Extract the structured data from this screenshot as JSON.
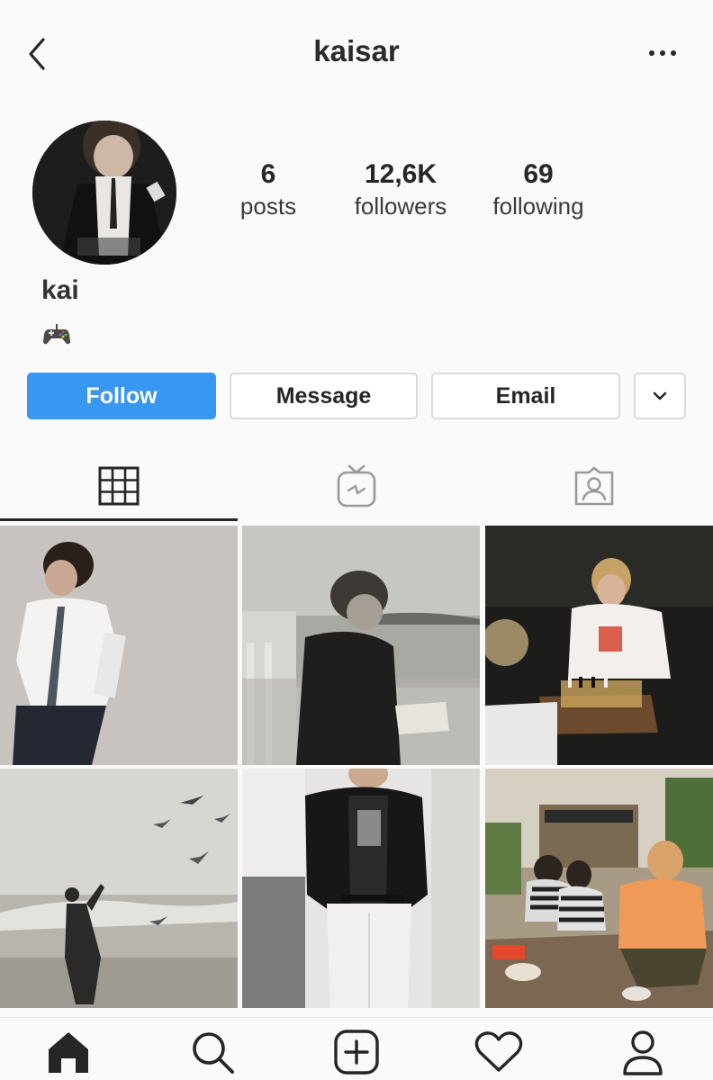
{
  "header": {
    "username": "kaisar",
    "back_icon": "chevron-left-icon",
    "more_icon": "more-horizontal-icon"
  },
  "profile": {
    "display_name": "kai",
    "bio_icon": "game-controller-emoji",
    "stats": [
      {
        "value": "6",
        "label": "posts"
      },
      {
        "value": "12,6K",
        "label": "followers"
      },
      {
        "value": "69",
        "label": "following"
      }
    ]
  },
  "actions": {
    "follow_label": "Follow",
    "message_label": "Message",
    "email_label": "Email",
    "dropdown_icon": "chevron-down-icon"
  },
  "tabs": [
    {
      "icon": "grid-icon",
      "active": true
    },
    {
      "icon": "igtv-icon",
      "active": false
    },
    {
      "icon": "tagged-icon",
      "active": false
    }
  ],
  "posts": [
    {
      "subject": "photo-person-white-shirt-tie"
    },
    {
      "subject": "photo-person-reading-by-sea-bw"
    },
    {
      "subject": "photo-person-playing-chess"
    },
    {
      "subject": "photo-person-on-beach-with-birds-bw"
    },
    {
      "subject": "photo-person-leather-jacket"
    },
    {
      "subject": "photo-group-sitting-on-floor"
    }
  ],
  "bottom_nav": [
    {
      "icon": "home-icon",
      "active": true
    },
    {
      "icon": "search-icon",
      "active": false
    },
    {
      "icon": "add-post-icon",
      "active": false
    },
    {
      "icon": "heart-icon",
      "active": false
    },
    {
      "icon": "profile-icon",
      "active": false
    }
  ],
  "colors": {
    "follow_button": "#3897f0",
    "background": "#fafafa",
    "border": "#dbdbdb"
  }
}
